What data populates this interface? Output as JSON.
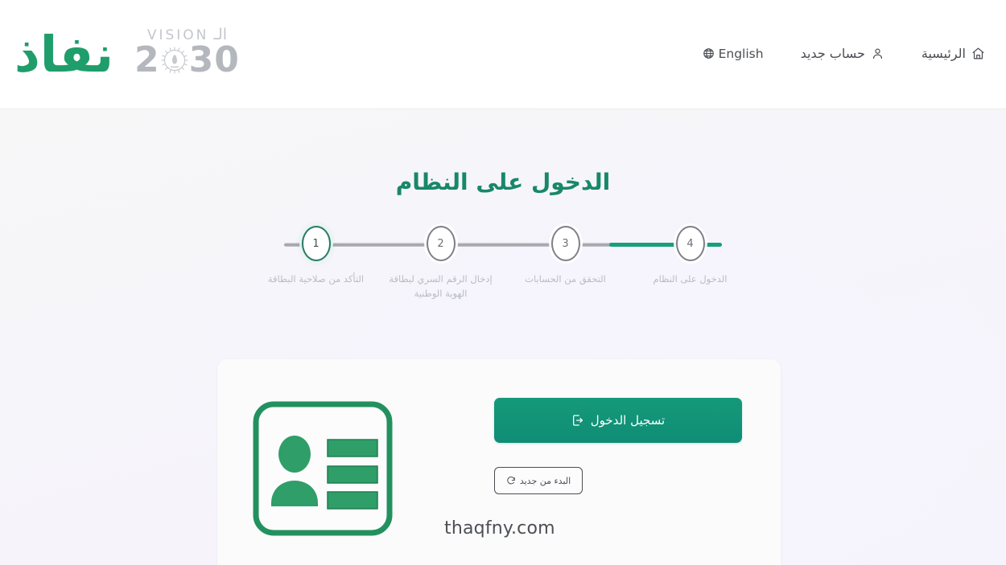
{
  "header": {
    "brand_name": "نفاذ",
    "vision": {
      "word": "VISION",
      "arabic": "الـ",
      "year_left": "2",
      "year_right": "30",
      "emblem": "vision-2030-emblem"
    },
    "nav": [
      {
        "id": "home",
        "label": "الرئيسية",
        "icon": "home-icon"
      },
      {
        "id": "new-user",
        "label": "حساب جديد",
        "icon": "user-icon"
      },
      {
        "id": "lang",
        "label": "English",
        "icon": "globe-icon"
      }
    ]
  },
  "main": {
    "title": "الدخول على النظام",
    "stepper": {
      "current": 1,
      "steps": [
        {
          "number": "4",
          "label": "الدخول على النظام",
          "state": "pending"
        },
        {
          "number": "3",
          "label": "التحقق من الحسابات",
          "state": "pending"
        },
        {
          "number": "2",
          "label": "إدخال الرقم السري لبطاقة الهوية الوطنية",
          "state": "pending"
        },
        {
          "number": "1",
          "label": "التأكد من صلاحية البطاقة",
          "state": "active"
        }
      ]
    },
    "card": {
      "illustration": "id-card-illustration",
      "login_button": {
        "label": "تسجيل الدخول",
        "icon": "login-arrow-icon"
      },
      "restart_button": {
        "label": "البدء من جديد",
        "icon": "refresh-icon"
      },
      "watermark": "thaqfny.com"
    }
  },
  "colors": {
    "brand_green": "#1f9d6b",
    "title_green": "#18876a",
    "primary_button": "#0f8d75",
    "track_done": "#17a07b",
    "track_pending": "#9a9aa2",
    "page_background": "#f5f3fb",
    "header_background": "#ffffff",
    "card_background": "#fbfbfc"
  }
}
